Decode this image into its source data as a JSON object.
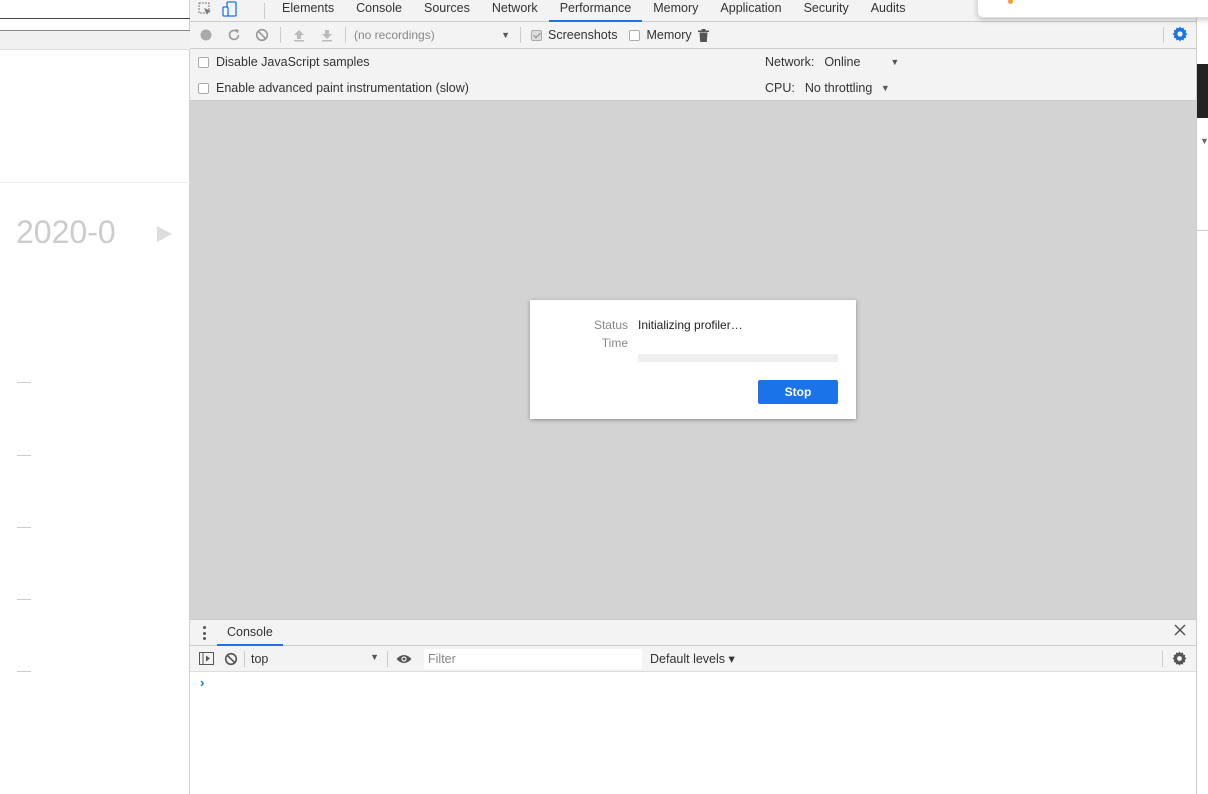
{
  "left_page": {
    "date_text": "2020-0",
    "dash_count": 5
  },
  "devtools": {
    "tabs": [
      {
        "label": "Elements",
        "active": false
      },
      {
        "label": "Console",
        "active": false
      },
      {
        "label": "Sources",
        "active": false
      },
      {
        "label": "Network",
        "active": false
      },
      {
        "label": "Performance",
        "active": true
      },
      {
        "label": "Memory",
        "active": false
      },
      {
        "label": "Application",
        "active": false
      },
      {
        "label": "Security",
        "active": false
      },
      {
        "label": "Audits",
        "active": false
      }
    ],
    "perf_toolbar": {
      "recordings_placeholder": "(no recordings)",
      "screenshots_label": "Screenshots",
      "screenshots_checked": true,
      "memory_label": "Memory",
      "memory_checked": false
    },
    "settings": {
      "disable_js_samples": "Disable JavaScript samples",
      "enable_paint": "Enable advanced paint instrumentation (slow)",
      "network_label": "Network:",
      "network_value": "Online",
      "cpu_label": "CPU:",
      "cpu_value": "No throttling"
    },
    "dialog": {
      "status_label": "Status",
      "status_value": "Initializing profiler…",
      "time_label": "Time",
      "time_value": "",
      "stop_label": "Stop"
    },
    "drawer": {
      "tab_label": "Console",
      "context_value": "top",
      "filter_placeholder": "Filter",
      "levels_label": "Default levels ▾",
      "prompt": "›"
    }
  },
  "colors": {
    "accent": "#1a73e8",
    "toolbar_bg": "#f3f3f3",
    "timeline_bg": "#d3d3d3"
  }
}
